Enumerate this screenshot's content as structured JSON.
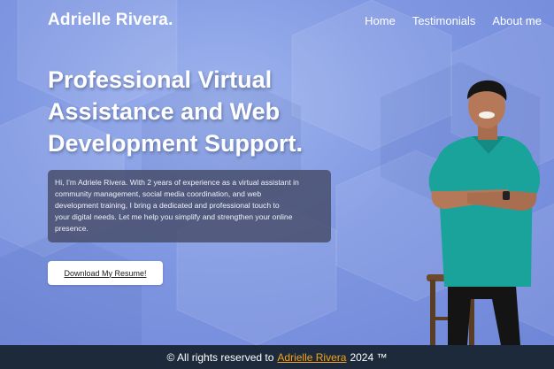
{
  "header": {
    "brand": "Adrielle Rivera.",
    "nav": [
      {
        "label": "Home"
      },
      {
        "label": "Testimonials"
      },
      {
        "label": "About me"
      }
    ]
  },
  "hero": {
    "headline_lines": [
      "Professional Virtual",
      "Assistance and Web",
      "Development Support."
    ],
    "intro_lines": [
      "Hi, I'm Adriele Rivera. With 2 years of experience as a virtual assistant in",
      "community management, social media coordination, and web",
      "development training, I bring a dedicated and professional touch to",
      "your digital needs. Let me help you simplify and strengthen your online",
      "presence."
    ],
    "resume_button": "Download My Resume!"
  },
  "footer": {
    "prefix": "© All rights reserved to",
    "name_link": "Adrielle Rivera",
    "suffix": "2024 ™"
  },
  "colors": {
    "background": "#7b95de",
    "footer_bg": "#1d2a3c",
    "footer_link": "#f3a21b",
    "shirt": "#1aa39a"
  },
  "icons": {
    "person_photo": "person-photo-icon"
  }
}
